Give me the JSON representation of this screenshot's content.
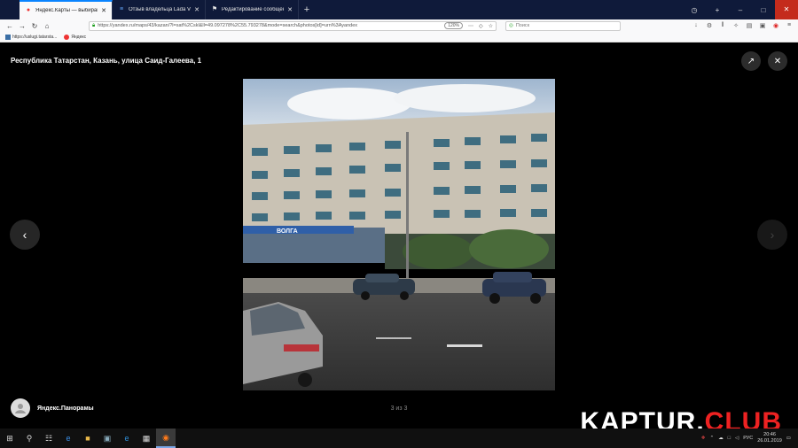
{
  "browser": {
    "tabs": [
      {
        "label": "Яндекс.Карты — выбирайте м",
        "active": true,
        "icon": "yandex-maps-icon"
      },
      {
        "label": "Отзыв владельца Lada Vesta S",
        "active": false,
        "icon": "drive-icon"
      },
      {
        "label": "Редактирование сообщения -",
        "active": false,
        "icon": "forum-icon"
      }
    ],
    "address": "https://yandex.ru/maps/43/kazan/?l=sat%2Cskl&ll=49.097278%2C55.793278&mode=search&photos[id]=urn%3Ayandex",
    "zoom": "120%",
    "search_placeholder": "Поиск",
    "bookmarks": [
      {
        "label": "https://uslugi.tatarsta..."
      },
      {
        "label": "Яндекс"
      }
    ]
  },
  "viewer": {
    "title": "Республика Татарстан, Казань, улица Саид-Галеева, 1",
    "author": "Яндекс.Панорамы",
    "counter": "3 из 3",
    "building_sign": "ВОЛГА"
  },
  "watermark": {
    "part1": "KAPTUR.",
    "part2": "CLUB"
  },
  "taskbar": {
    "lang": "РУС",
    "time": "20:46",
    "date": "26.01.2019"
  }
}
